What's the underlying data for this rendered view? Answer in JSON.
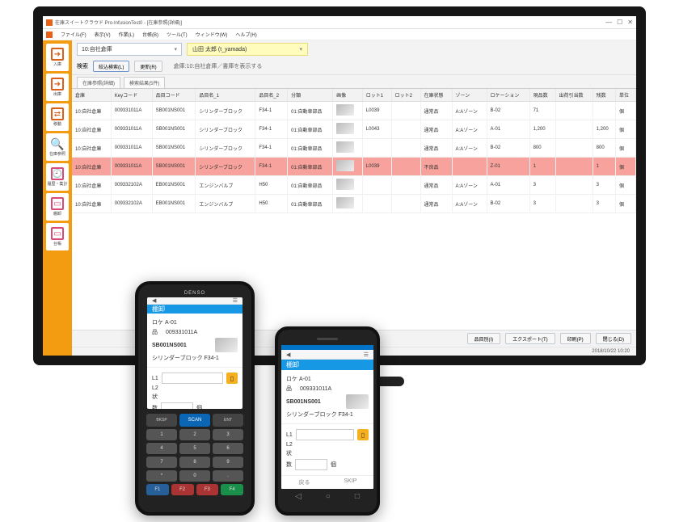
{
  "window": {
    "title": "在庫スイートクラウド Pro-InfusionTest0 - [在庫参照(詳細)]",
    "controls": {
      "min": "—",
      "max": "☐",
      "close": "✕"
    }
  },
  "menubar": [
    "ファイル(F)",
    "表示(V)",
    "作業(L)",
    "台帳(B)",
    "ツール(T)",
    "ウィンドウ(W)",
    "ヘルプ(H)"
  ],
  "sidebar": {
    "items": [
      {
        "label": "入庫",
        "glyph": "➜"
      },
      {
        "label": "出庫",
        "glyph": "➜"
      },
      {
        "label": "移動",
        "glyph": "⇄"
      },
      {
        "label": "在庫参照",
        "glyph": "🔍"
      },
      {
        "label": "履歴・集計",
        "glyph": "🕘"
      },
      {
        "label": "棚卸",
        "glyph": "▭"
      },
      {
        "label": "台帳",
        "glyph": "▭"
      }
    ]
  },
  "filters": {
    "warehouse": "10:自社倉庫",
    "user": "山田 太郎 (t_yamada)",
    "search_label": "検索",
    "btn_search": "絞込検索(L)",
    "btn_update": "更新(R)",
    "scope_note": "倉庫:10:自社倉庫／書庫を表示する"
  },
  "tabs": {
    "left": "在庫参照(詳細)",
    "right": "検索結果(5件)"
  },
  "table": {
    "headers": [
      "倉庫",
      "Keyコード",
      "品目コード",
      "品目名_1",
      "品目名_2",
      "分類",
      "画像",
      "ロット1",
      "ロット2",
      "在庫状態",
      "ゾーン",
      "ロケーション",
      "現品数",
      "出荷引当数",
      "残数",
      "単位"
    ],
    "rows": [
      {
        "warehouse": "10:自社倉庫",
        "key": "009331011A",
        "code": "SB001NS001",
        "name1": "シリンダーブロック",
        "name2": "F34-1",
        "cat": "01:自動車部品",
        "lot1": "L0039",
        "lot2": "",
        "state": "通常品",
        "zone": "A:Aゾーン",
        "loc": "B-02",
        "qty": "71",
        "alloc": "",
        "remain": "",
        "unit": "個",
        "hl": false
      },
      {
        "warehouse": "10:自社倉庫",
        "key": "009331011A",
        "code": "SB001NS001",
        "name1": "シリンダーブロック",
        "name2": "F34-1",
        "cat": "01:自動車部品",
        "lot1": "L0043",
        "lot2": "",
        "state": "通常品",
        "zone": "A:Aゾーン",
        "loc": "A-01",
        "qty": "1,200",
        "alloc": "",
        "remain": "1,200",
        "unit": "個",
        "hl": false
      },
      {
        "warehouse": "10:自社倉庫",
        "key": "009331011A",
        "code": "SB001NS001",
        "name1": "シリンダーブロック",
        "name2": "F34-1",
        "cat": "01:自動車部品",
        "lot1": "",
        "lot2": "",
        "state": "通常品",
        "zone": "A:Aゾーン",
        "loc": "B-02",
        "qty": "800",
        "alloc": "",
        "remain": "800",
        "unit": "個",
        "hl": false
      },
      {
        "warehouse": "10:自社倉庫",
        "key": "009331011A",
        "code": "SB001NS001",
        "name1": "シリンダーブロック",
        "name2": "F34-1",
        "cat": "01:自動車部品",
        "lot1": "L0039",
        "lot2": "",
        "state": "不良品",
        "zone": "",
        "loc": "Z-01",
        "qty": "1",
        "alloc": "",
        "remain": "1",
        "unit": "個",
        "hl": true
      },
      {
        "warehouse": "10:自社倉庫",
        "key": "009332102A",
        "code": "EB001NS001",
        "name1": "エンジンバルブ",
        "name2": "H50",
        "cat": "01:自動車部品",
        "lot1": "",
        "lot2": "",
        "state": "通常品",
        "zone": "A:Aゾーン",
        "loc": "A-01",
        "qty": "3",
        "alloc": "",
        "remain": "3",
        "unit": "個",
        "hl": false
      },
      {
        "warehouse": "10:自社倉庫",
        "key": "009332102A",
        "code": "EB001NS001",
        "name1": "エンジンバルブ",
        "name2": "H50",
        "cat": "01:自動車部品",
        "lot1": "",
        "lot2": "",
        "state": "通常品",
        "zone": "A:Aゾーン",
        "loc": "B-02",
        "qty": "3",
        "alloc": "",
        "remain": "3",
        "unit": "個",
        "hl": false
      }
    ]
  },
  "footer": {
    "buttons": [
      "品目別(I)",
      "エクスポート(T)",
      "印刷(P)",
      "閉じる(D)"
    ],
    "timestamp": "2018/10/22  10:20"
  },
  "mobile": {
    "brand": "DENSO",
    "title": "棚卸",
    "locLabel": "ロケ A-01",
    "itemLabel": "品",
    "itemKey": "009331011A",
    "itemCode": "SB001NS001",
    "itemName": "シリンダーブロック F34-1",
    "l1": "L1",
    "l2": "L2",
    "state": "状",
    "qty": "数",
    "unit": "個",
    "back": "戻る",
    "skip": "SKIP"
  },
  "keypad": {
    "bksp": "BKSP",
    "scan": "SCAN",
    "ent": "ENT",
    "rows": [
      [
        "1",
        "2",
        "3"
      ],
      [
        "4",
        "5",
        "6"
      ],
      [
        "7",
        "8",
        "9"
      ],
      [
        "*",
        "0",
        "."
      ]
    ],
    "nav": [
      "F1",
      "F2",
      "F3",
      "F4"
    ]
  },
  "phoneNav": {
    "back": "◁",
    "home": "○",
    "recent": "□"
  }
}
